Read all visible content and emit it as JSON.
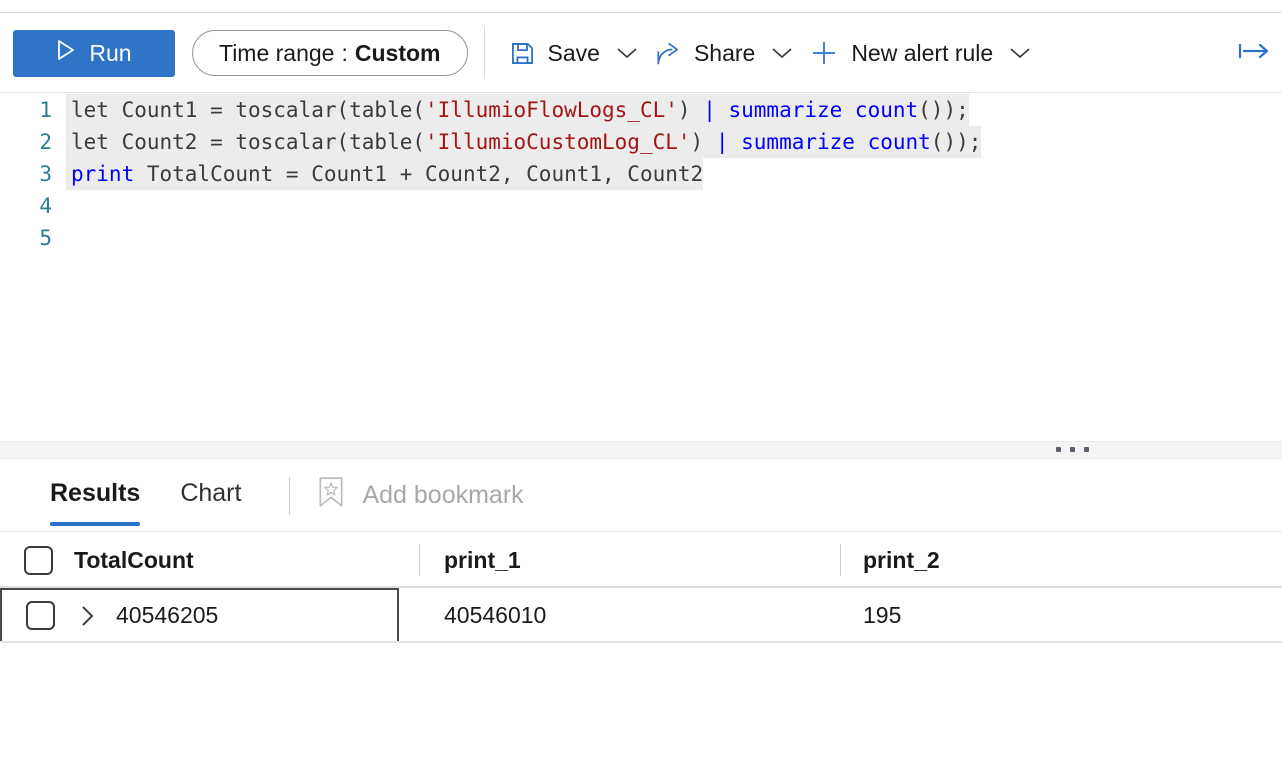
{
  "toolbar": {
    "run_label": "Run",
    "run_icon": "play-triangle-icon",
    "time_range_label": "Time range",
    "time_range_colon": ":",
    "time_range_value": "Custom",
    "save_label": "Save",
    "save_icon": "floppy-disk-icon",
    "share_label": "Share",
    "share_icon": "share-arrow-icon",
    "new_alert_label": "New alert rule",
    "new_alert_icon": "plus-icon",
    "caret_icon": "chevron-down-icon",
    "expand_icon": "arrow-to-right-icon",
    "accent_color": "#3074c8"
  },
  "editor": {
    "lines": [
      {
        "number": "1",
        "selected": true,
        "tokens": [
          {
            "text": "let Count1 = toscalar(table(",
            "cls": "tok-plain"
          },
          {
            "text": "'IllumioFlowLogs_CL'",
            "cls": "tok-str"
          },
          {
            "text": ") ",
            "cls": "tok-plain"
          },
          {
            "text": "|",
            "cls": "tok-op"
          },
          {
            "text": " ",
            "cls": "tok-plain"
          },
          {
            "text": "summarize count",
            "cls": "tok-kw"
          },
          {
            "text": "());",
            "cls": "tok-plain"
          }
        ]
      },
      {
        "number": "2",
        "selected": true,
        "tokens": [
          {
            "text": "let Count2 = toscalar(table(",
            "cls": "tok-plain"
          },
          {
            "text": "'IllumioCustomLog_CL'",
            "cls": "tok-str"
          },
          {
            "text": ") ",
            "cls": "tok-plain"
          },
          {
            "text": "|",
            "cls": "tok-op"
          },
          {
            "text": " ",
            "cls": "tok-plain"
          },
          {
            "text": "summarize count",
            "cls": "tok-kw"
          },
          {
            "text": "());",
            "cls": "tok-plain"
          }
        ]
      },
      {
        "number": "3",
        "selected": true,
        "tokens": [
          {
            "text": "print",
            "cls": "tok-kw"
          },
          {
            "text": " TotalCount = Count1 + Count2, Count1, Count2",
            "cls": "tok-plain"
          }
        ]
      },
      {
        "number": "4",
        "selected": false,
        "tokens": []
      },
      {
        "number": "5",
        "selected": false,
        "tokens": []
      }
    ]
  },
  "results": {
    "tabs": [
      {
        "label": "Results",
        "active": true
      },
      {
        "label": "Chart",
        "active": false
      }
    ],
    "bookmark_label": "Add bookmark",
    "bookmark_icon": "bookmark-star-icon",
    "columns": [
      "TotalCount",
      "print_1",
      "print_2"
    ],
    "rows": [
      {
        "expand_icon": "chevron-right-icon",
        "cells": [
          "40546205",
          "40546010",
          "195"
        ]
      }
    ]
  }
}
